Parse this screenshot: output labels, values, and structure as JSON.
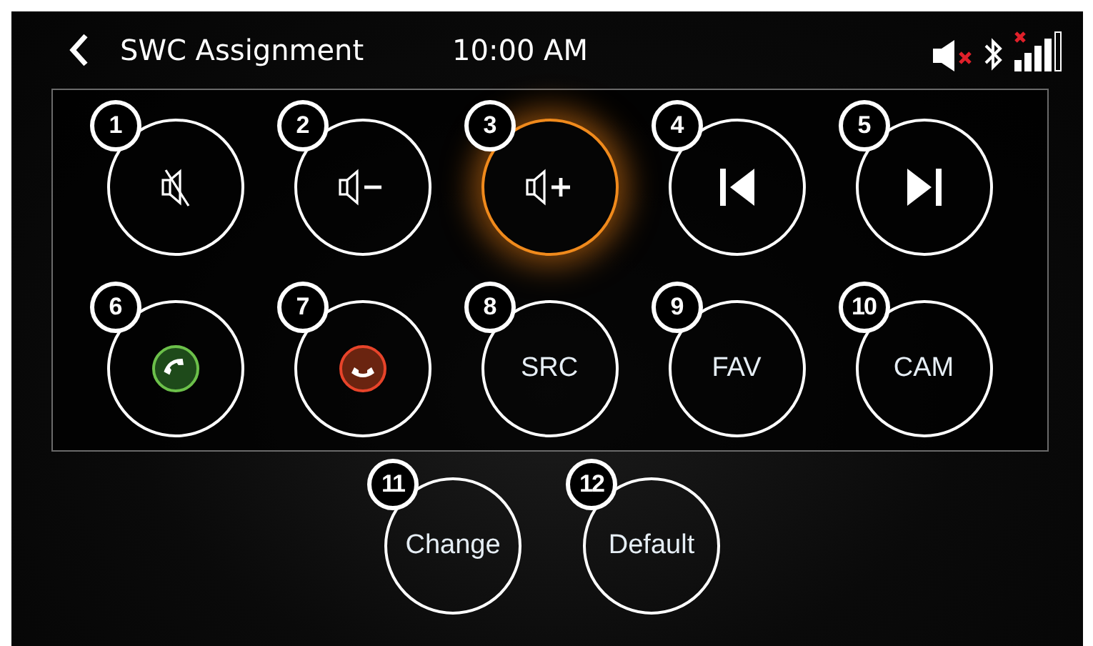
{
  "header": {
    "title": "SWC Assignment",
    "time": "10:00 AM"
  },
  "keys": [
    {
      "number": "1",
      "kind": "mute",
      "selected": false
    },
    {
      "number": "2",
      "kind": "volume-down",
      "selected": false
    },
    {
      "number": "3",
      "kind": "volume-up",
      "selected": true
    },
    {
      "number": "4",
      "kind": "previous",
      "selected": false
    },
    {
      "number": "5",
      "kind": "next",
      "selected": false
    },
    {
      "number": "6",
      "kind": "call-answer",
      "selected": false
    },
    {
      "number": "7",
      "kind": "call-end",
      "selected": false
    },
    {
      "number": "8",
      "kind": "text",
      "label": "SRC",
      "selected": false
    },
    {
      "number": "9",
      "kind": "text",
      "label": "FAV",
      "selected": false
    },
    {
      "number": "10",
      "kind": "text",
      "label": "CAM",
      "selected": false
    }
  ],
  "actions": [
    {
      "number": "11",
      "label": "Change"
    },
    {
      "number": "12",
      "label": "Default"
    }
  ]
}
